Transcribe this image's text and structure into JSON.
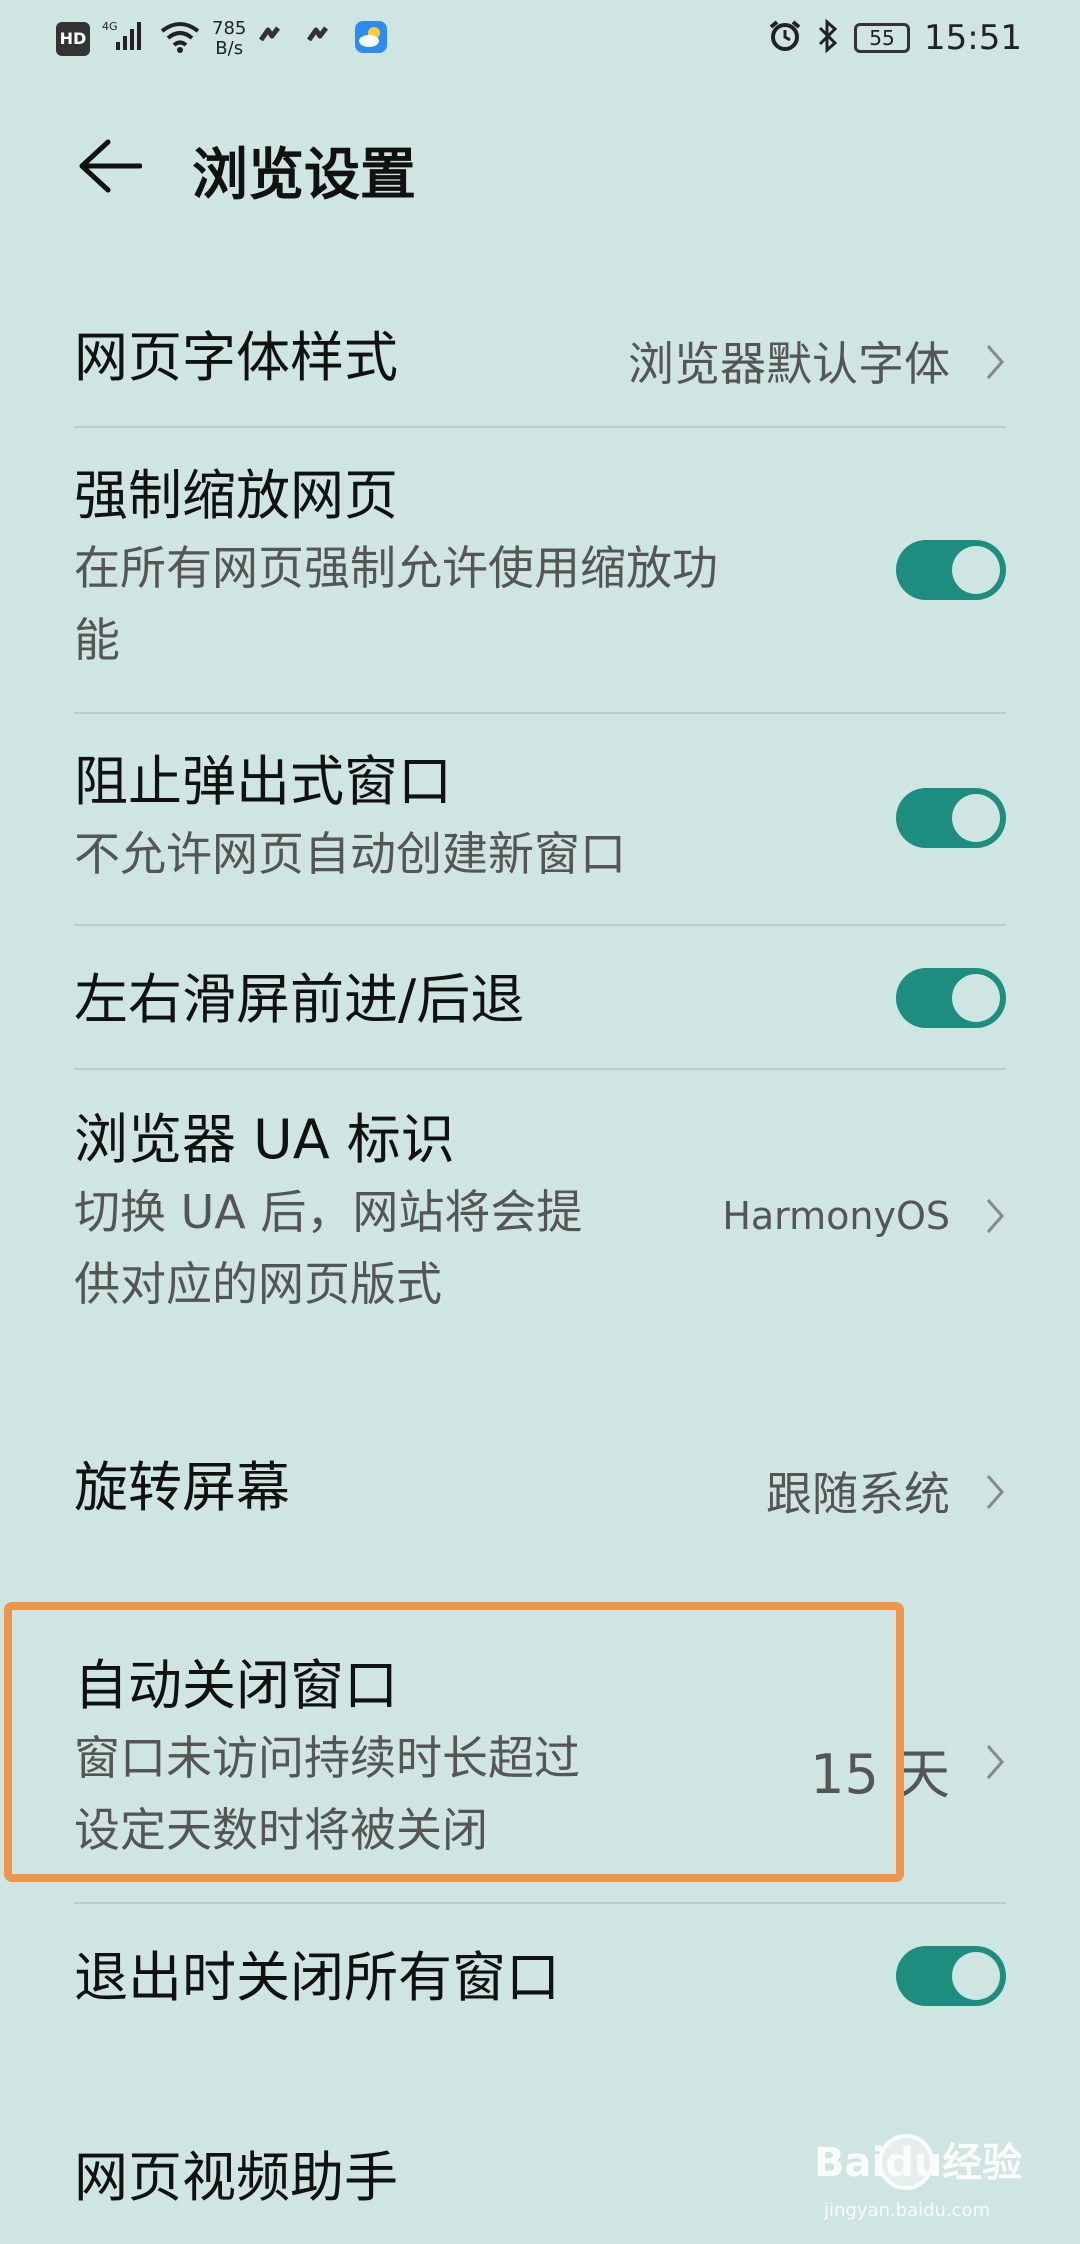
{
  "status_bar": {
    "hd": "HD",
    "network": "4G",
    "speed_top": "785",
    "speed_bottom": "B/s",
    "battery": "55",
    "time": "15:51"
  },
  "header": {
    "title": "浏览设置"
  },
  "settings": {
    "font_style": {
      "title": "网页字体样式",
      "value": "浏览器默认字体"
    },
    "force_zoom": {
      "title": "强制缩放网页",
      "subtitle_1": "在所有网页强制允许使用缩放功",
      "subtitle_2": "能",
      "enabled": true
    },
    "block_popups": {
      "title": "阻止弹出式窗口",
      "subtitle": "不允许网页自动创建新窗口",
      "enabled": true
    },
    "swipe_nav": {
      "title": "左右滑屏前进/后退",
      "enabled": true
    },
    "ua": {
      "title": "浏览器 UA 标识",
      "subtitle_1": "切换 UA 后，网站将会提",
      "subtitle_2": "供对应的网页版式",
      "value": "HarmonyOS"
    },
    "rotate": {
      "title": "旋转屏幕",
      "value": "跟随系统"
    },
    "auto_close": {
      "title": "自动关闭窗口",
      "subtitle_1": "窗口未访问持续时长超过",
      "subtitle_2": "设定天数时将被关闭",
      "value": "15 天"
    },
    "close_on_exit": {
      "title": "退出时关闭所有窗口",
      "enabled": true
    },
    "video_helper": {
      "title": "网页视频助手"
    }
  },
  "colors": {
    "background": "#cfe5e2",
    "toggle_on": "#1d8d7f",
    "highlight": "#f0954a"
  },
  "watermark": {
    "text": "Baidu经验",
    "url": "jingyan.baidu.com"
  }
}
